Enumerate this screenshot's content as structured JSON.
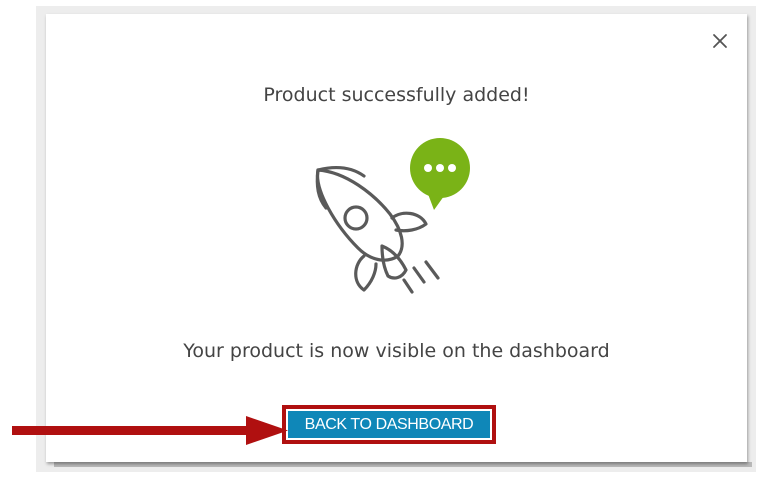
{
  "modal": {
    "title": "Product successfully added!",
    "message": "Your product is now visible on the dashboard",
    "back_button_label": "BACK TO DASHBOARD"
  },
  "icons": {
    "close": "close-icon",
    "illustration": "rocket-icon",
    "badge": "chat-bubble-icon",
    "arrow": "arrow-right-icon"
  },
  "colors": {
    "button": "#0f87b8",
    "highlight": "#b01010",
    "badge": "#7ab317",
    "text": "#444444"
  }
}
